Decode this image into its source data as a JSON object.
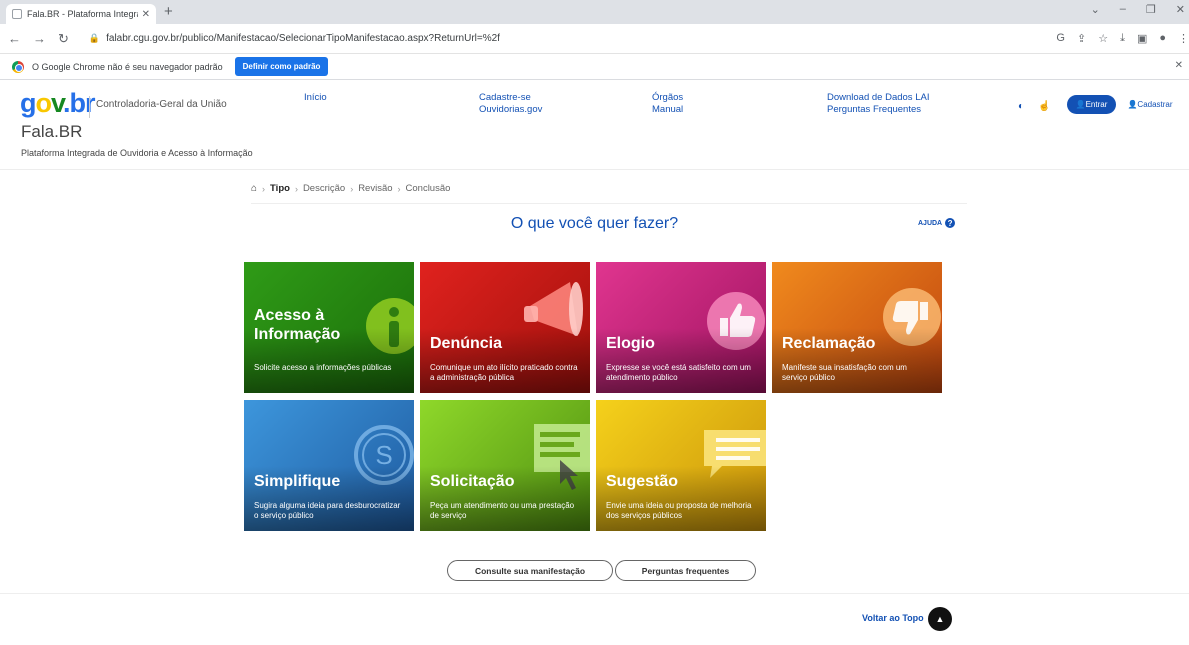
{
  "browser": {
    "tab_title": "Fala.BR - Plataforma Integrada d",
    "url": "falabr.cgu.gov.br/publico/Manifestacao/SelecionarTipoManifestacao.aspx?ReturnUrl=%2f",
    "infobar_text": "O Google Chrome não é seu navegador padrão",
    "infobar_button": "Definir como padrão"
  },
  "header": {
    "logo": {
      "g": "g",
      "o": "o",
      "v": "v",
      "dot": ".",
      "b": "br"
    },
    "org_name": "Controladoria-Geral da União",
    "site_title": "Fala.BR",
    "site_subtitle": "Plataforma Integrada de Ouvidoria e Acesso à Informação",
    "nav": [
      {
        "line1": "Início",
        "line2": ""
      },
      {
        "line1": "Cadastre-se",
        "line2": "Ouvidorias.gov"
      },
      {
        "line1": "Órgãos",
        "line2": "Manual"
      },
      {
        "line1": "Download de Dados LAI",
        "line2": "Perguntas Frequentes"
      }
    ],
    "entrar": "Entrar",
    "cadastrar": "Cadastrar"
  },
  "breadcrumb": {
    "steps": [
      "Tipo",
      "Descrição",
      "Revisão",
      "Conclusão"
    ]
  },
  "main": {
    "question": "O que você quer fazer?",
    "help": "AJUDA"
  },
  "tiles": [
    {
      "name": "Acesso à",
      "name2": "Informação",
      "desc": "Solicite acesso a informações públicas",
      "color": "#2f9b17"
    },
    {
      "name": "Denúncia",
      "desc": "Comunique um ato ilícito praticado contra a administração pública",
      "color": "#e0221e"
    },
    {
      "name": "Elogio",
      "desc": "Expresse se você está satisfeito com um atendimento público",
      "color": "#e0358f"
    },
    {
      "name": "Reclamação",
      "desc": "Manifeste sua insatisfação com um serviço público",
      "color": "#f08a1d"
    },
    {
      "name": "Simplifique",
      "desc": "Sugira alguma ideia para desburocratizar o serviço público",
      "color": "#3d96dc"
    },
    {
      "name": "Solicitação",
      "desc": "Peça um atendimento ou uma prestação de serviço",
      "color": "#8fd82a"
    },
    {
      "name": "Sugestão",
      "desc": "Envie uma ideia ou proposta de melhoria dos serviços públicos",
      "color": "#f5d11b"
    }
  ],
  "actions": {
    "consulte": "Consulte sua manifestação",
    "perguntas": "Perguntas frequentes"
  },
  "footer": {
    "back_to_top": "Voltar ao Topo"
  }
}
